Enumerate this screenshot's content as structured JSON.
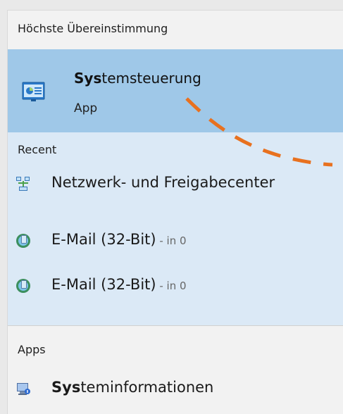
{
  "best_match": {
    "header": "Höchste Übereinstimmung",
    "title_bold": "Sys",
    "title_rest": "temsteuerung",
    "subtitle": "App",
    "icon": "control-panel-icon"
  },
  "recent": {
    "header": "Recent",
    "items": [
      {
        "label": "Netzwerk- und Freigabecenter",
        "suffix": "",
        "icon": "network-sharing-icon"
      },
      {
        "label": "E-Mail (32-Bit)",
        "suffix": " - in 0",
        "icon": "mail-icon"
      },
      {
        "label": "E-Mail (32-Bit)",
        "suffix": " - in 0",
        "icon": "mail-icon"
      }
    ]
  },
  "apps": {
    "header": "Apps",
    "items": [
      {
        "label_bold": "Sys",
        "label_rest": "teminformationen",
        "icon": "system-information-icon"
      }
    ]
  },
  "colors": {
    "selected_bg": "#9fc8e8",
    "recent_bg": "#dbe9f6",
    "panel_bg": "#f2f2f2",
    "annotation": "#e8711f"
  }
}
